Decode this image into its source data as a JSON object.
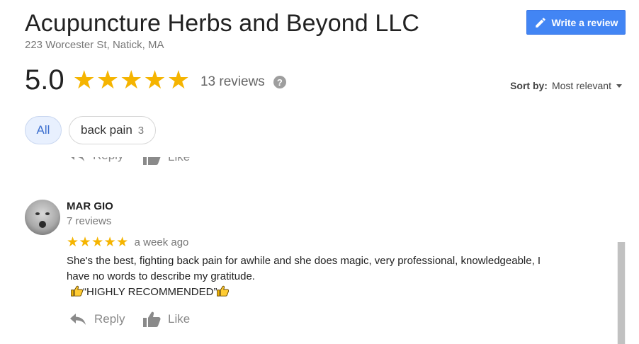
{
  "business": {
    "name": "Acupuncture Herbs and Beyond LLC",
    "address": "223 Worcester St, Natick, MA"
  },
  "header": {
    "write_review_label": "Write a review",
    "accent_color": "#4285f4"
  },
  "rating": {
    "score_text": "5.0",
    "stars_text": "★★★★★",
    "stars_value": 5,
    "reviews_label": "13 reviews",
    "help_icon_glyph": "?"
  },
  "sort": {
    "label": "Sort by:",
    "value": "Most relevant"
  },
  "filters": [
    {
      "label": "All",
      "count": ""
    },
    {
      "label": "back pain",
      "count": "3"
    }
  ],
  "actions": {
    "reply_label": "Reply",
    "like_label": "Like"
  },
  "review": {
    "author": "MAR GIO",
    "author_reviews": "7 reviews",
    "stars_text": "★★★★★",
    "stars_value": 5,
    "time": "a week ago",
    "text_line1": "She's the best, fighting back pain for awhile and she does magic, very professional, knowledgeable, I",
    "text_line2": "have no words to describe my gratitude.",
    "text_line3": "“HIGHLY RECOMMENDED”",
    "text_icons": "thumbs-up-emoji"
  },
  "colors": {
    "star": "#f5b400",
    "chip_active_bg": "#e8f0fe",
    "chip_active_text": "#3c6fcf",
    "muted_text": "#777777"
  }
}
